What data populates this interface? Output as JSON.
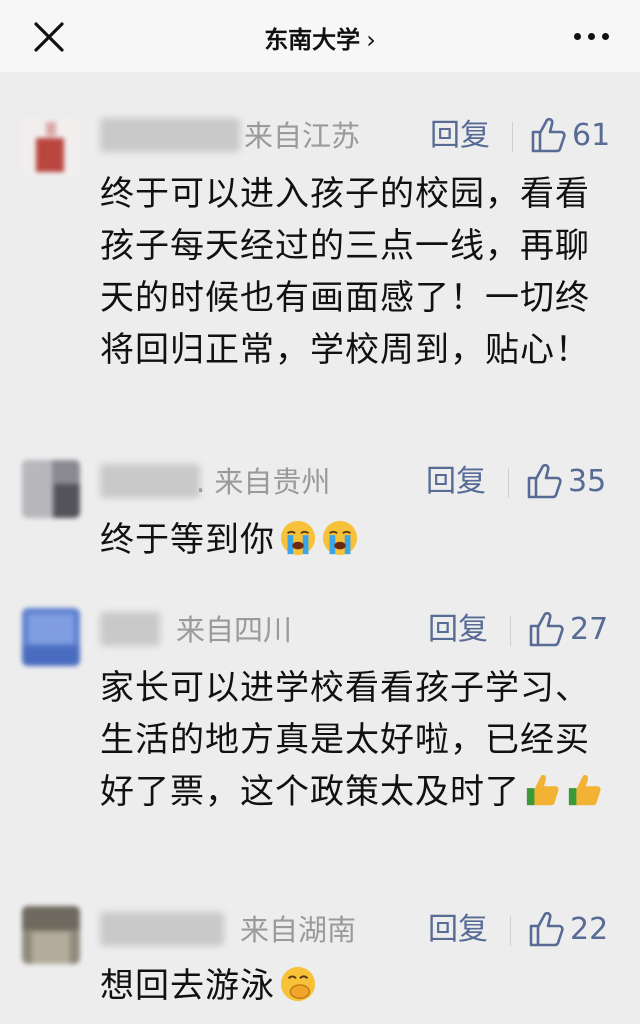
{
  "header": {
    "title": "东南大学",
    "chevron": "›",
    "close_icon": "close-icon",
    "more_icon": "more-icon"
  },
  "comments": [
    {
      "location": "来自江苏",
      "reply_label": "回复",
      "likes": "61",
      "text": "终于可以进入孩子的校园，看看孩子每天经过的三点一线，再聊天的时候也有画面感了！一切终将回归正常，学校周到，贴心！"
    },
    {
      "location": ". 来自贵州",
      "reply_label": "回复",
      "likes": "35",
      "text": "终于等到你",
      "emojis": [
        "loudly-crying-face",
        "loudly-crying-face"
      ]
    },
    {
      "location": "来自四川",
      "reply_label": "回复",
      "likes": "27",
      "text": "家长可以进学校看看孩子学习、生活的地方真是太好啦，已经买好了票，这个政策太及时了",
      "emojis": [
        "thumbs-up",
        "thumbs-up"
      ]
    },
    {
      "location": "来自湖南",
      "reply_label": "回复",
      "likes": "22",
      "text": "想回去游泳",
      "emojis": [
        "face-with-hand-over-mouth"
      ]
    }
  ],
  "colors": {
    "background": "#ededed",
    "link_blue": "#576b95",
    "location_gray": "#9a9a9a",
    "text": "#111111"
  }
}
